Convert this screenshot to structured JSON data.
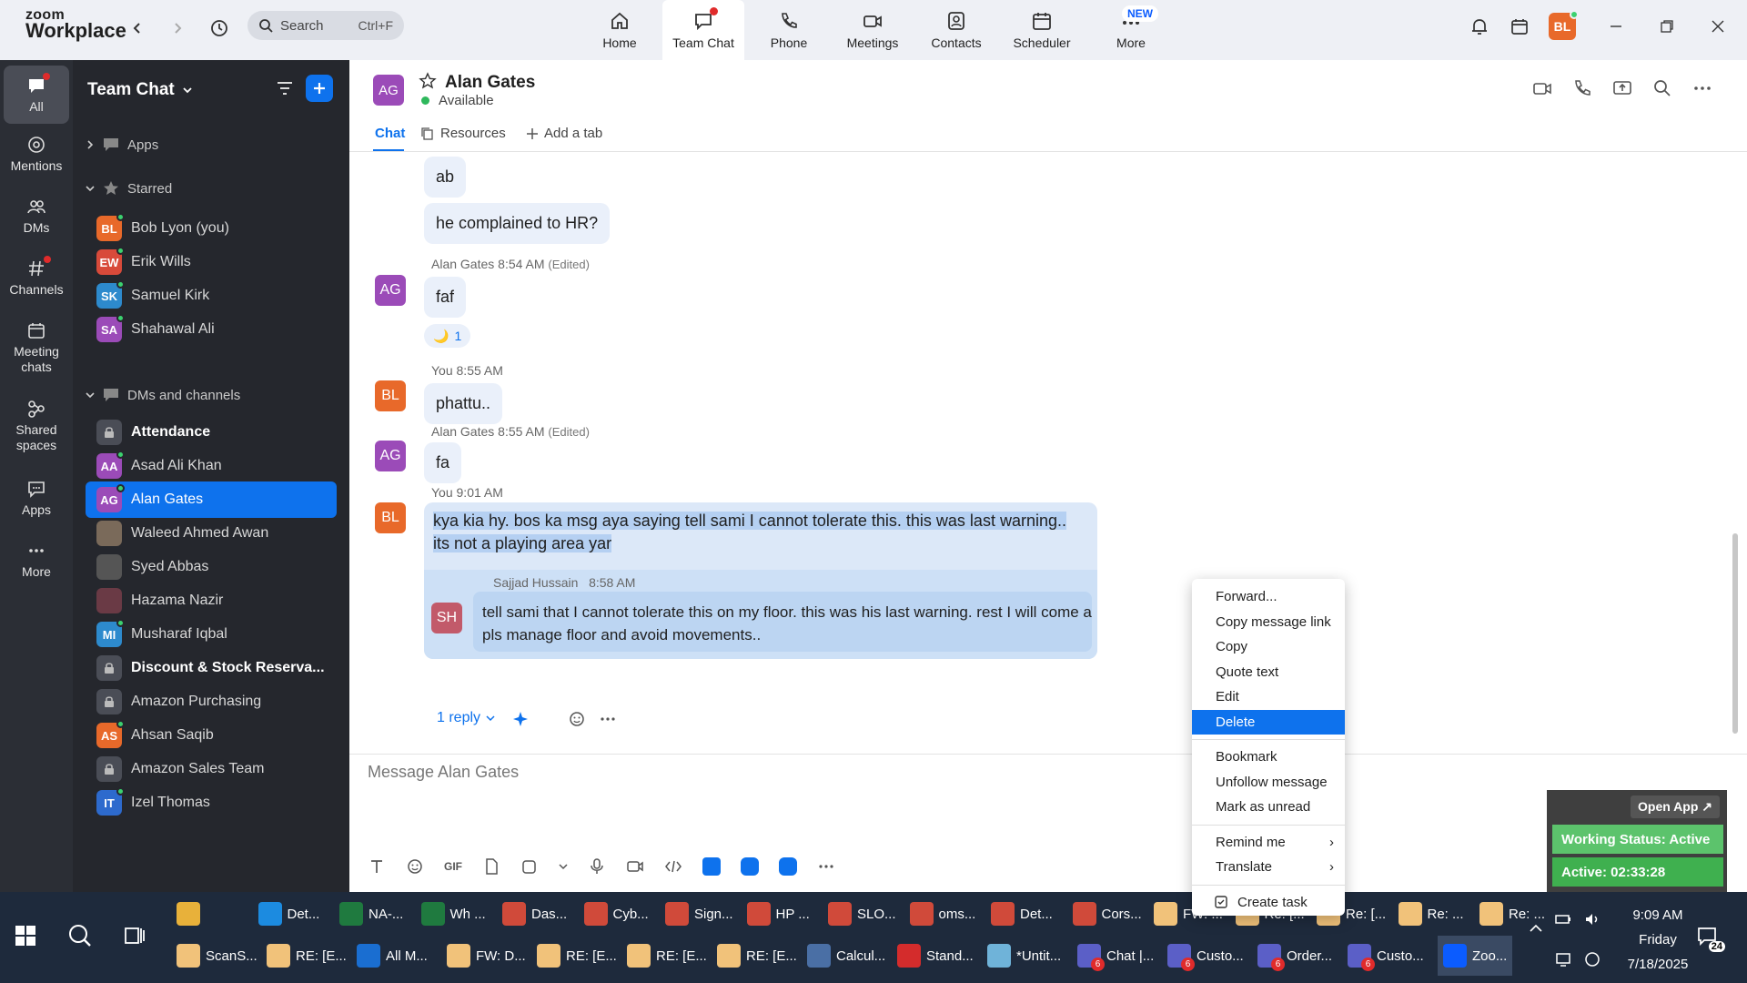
{
  "app": {
    "logo_line1": "zoom",
    "logo_line2": "Workplace"
  },
  "search": {
    "label": "Search",
    "shortcut": "Ctrl+F"
  },
  "nav": [
    {
      "label": "Home",
      "icon": "home-icon"
    },
    {
      "label": "Team Chat",
      "icon": "chat-icon"
    },
    {
      "label": "Phone",
      "icon": "phone-icon"
    },
    {
      "label": "Meetings",
      "icon": "video-icon"
    },
    {
      "label": "Contacts",
      "icon": "contacts-icon"
    },
    {
      "label": "Scheduler",
      "icon": "calendar-icon"
    },
    {
      "label": "More",
      "icon": "more-icon"
    }
  ],
  "new_badge": "NEW",
  "user_avatar": "BL",
  "rail": [
    {
      "label": "All"
    },
    {
      "label": "Mentions"
    },
    {
      "label": "DMs"
    },
    {
      "label": "Channels"
    },
    {
      "label": "Meeting chats"
    },
    {
      "label": "Shared spaces"
    },
    {
      "label": "Apps"
    },
    {
      "label": "More"
    }
  ],
  "side": {
    "title": "Team Chat",
    "apps_label": "Apps",
    "starred_label": "Starred",
    "starred": [
      {
        "initials": "BL",
        "name": "Bob Lyon (you)",
        "color": "#e8692a"
      },
      {
        "initials": "EW",
        "name": "Erik Wills",
        "color": "#d84a3a"
      },
      {
        "initials": "SK",
        "name": "Samuel Kirk",
        "color": "#2d8acd"
      },
      {
        "initials": "SA",
        "name": "Shahawal Ali",
        "color": "#9b4bb8"
      }
    ],
    "dms_label": "DMs and channels",
    "dms": [
      {
        "initials": "",
        "name": "Attendance",
        "color": "#4a4d56",
        "bold": true,
        "lock": true
      },
      {
        "initials": "AA",
        "name": "Asad Ali Khan",
        "color": "#9b4bb8"
      },
      {
        "initials": "AG",
        "name": "Alan Gates",
        "color": "#9b4bb8",
        "sel": true
      },
      {
        "initials": "",
        "name": "Waleed Ahmed Awan",
        "color": "#7a6a5a"
      },
      {
        "initials": "",
        "name": "Syed Abbas",
        "color": "#555"
      },
      {
        "initials": "",
        "name": "Hazama Nazir",
        "color": "#6a3a45"
      },
      {
        "initials": "MI",
        "name": "Musharaf Iqbal",
        "color": "#2d8acd"
      },
      {
        "initials": "",
        "name": "Discount & Stock Reserva...",
        "color": "#4a4d56",
        "bold": true,
        "lock": true
      },
      {
        "initials": "",
        "name": "Amazon Purchasing",
        "color": "#4a4d56",
        "lock": true
      },
      {
        "initials": "AS",
        "name": "Ahsan Saqib",
        "color": "#e8692a"
      },
      {
        "initials": "",
        "name": "Amazon Sales Team",
        "color": "#4a4d56",
        "lock": true
      },
      {
        "initials": "IT",
        "name": "Izel Thomas",
        "color": "#2d6acd"
      }
    ]
  },
  "chat": {
    "contact_initials": "AG",
    "contact_name": "Alan Gates",
    "contact_status": "Available",
    "tabs": [
      "Chat",
      "Resources",
      "Add a tab"
    ],
    "msg1": "ab",
    "msg2": "he complained to HR?",
    "meta3_name": "Alan Gates",
    "meta3_time": "8:54 AM",
    "meta3_edited": "(Edited)",
    "msg3": "faf",
    "reaction": "1",
    "meta4_name": "You",
    "meta4_time": "8:55 AM",
    "msg4": "phattu..",
    "meta5_name": "Alan Gates",
    "meta5_time": "8:55 AM",
    "meta5_edited": "(Edited)",
    "msg5": "fa",
    "meta6_name": "You",
    "meta6_time": "9:01 AM",
    "msg6_line1": "kya kia hy. bos ka msg aya saying tell sami I cannot tolerate this. this was last warning..",
    "msg6_line2": "its not a playing area yar",
    "quote_initials": "SH",
    "quote_name": "Sajjad Hussain",
    "quote_time": "8:58 AM",
    "quote_line1": "tell sami that I cannot tolerate this on my floor. this was his last warning. rest I will come and",
    "quote_line2": "pls manage floor and avoid movements..",
    "reply_label": "1 reply",
    "input_placeholder": "Message Alan Gates",
    "bl": "BL",
    "ag": "AG"
  },
  "context_menu": {
    "items1": [
      "Forward...",
      "Copy message link",
      "Copy",
      "Quote text",
      "Edit",
      "Delete"
    ],
    "items2": [
      "Bookmark",
      "Unfollow message",
      "Mark as unread"
    ],
    "items3": [
      "Remind me",
      "Translate"
    ],
    "items4": [
      "Create task"
    ],
    "highlighted": "Delete"
  },
  "widget": {
    "open_app": "Open App ↗",
    "working": "Working Status: Active",
    "active": "Active: 02:33:28"
  },
  "taskbar": {
    "row1": [
      {
        "label": "",
        "color": "#e8b13a"
      },
      {
        "label": "Det...",
        "color": "#1c8be0"
      },
      {
        "label": "NA-...",
        "color": "#1f7a3f"
      },
      {
        "label": "Wh ...",
        "color": "#1f7a3f"
      },
      {
        "label": "Das...",
        "color": "#d04a3a"
      },
      {
        "label": "Cyb...",
        "color": "#d04a3a"
      },
      {
        "label": "Sign...",
        "color": "#d04a3a"
      },
      {
        "label": "HP ...",
        "color": "#d04a3a"
      },
      {
        "label": "SLO...",
        "color": "#d04a3a"
      },
      {
        "label": "oms...",
        "color": "#d04a3a"
      },
      {
        "label": "Det...",
        "color": "#d04a3a"
      },
      {
        "label": "Cors...",
        "color": "#d04a3a"
      },
      {
        "label": "FW: ...",
        "color": "#f1c27a"
      },
      {
        "label": "Re: [...",
        "color": "#f1c27a"
      },
      {
        "label": "Re: [...",
        "color": "#f1c27a"
      },
      {
        "label": "Re: ...",
        "color": "#f1c27a"
      },
      {
        "label": "Re: ...",
        "color": "#f1c27a"
      }
    ],
    "row2": [
      {
        "label": "ScanS...",
        "color": "#f1c27a"
      },
      {
        "label": "RE: [E...",
        "color": "#f1c27a"
      },
      {
        "label": "All M...",
        "color": "#1a6ed1"
      },
      {
        "label": "FW: D...",
        "color": "#f1c27a"
      },
      {
        "label": "RE: [E...",
        "color": "#f1c27a"
      },
      {
        "label": "RE: [E...",
        "color": "#f1c27a"
      },
      {
        "label": "RE: [E...",
        "color": "#f1c27a"
      },
      {
        "label": "Calcul...",
        "color": "#4a6fa5"
      },
      {
        "label": "Stand...",
        "color": "#d42c2c"
      },
      {
        "label": "*Untit...",
        "color": "#6fb3d9"
      },
      {
        "label": "Chat |...",
        "color": "#5b5fc7",
        "badge": "6"
      },
      {
        "label": "Custo...",
        "color": "#5b5fc7",
        "badge": "6"
      },
      {
        "label": "Order...",
        "color": "#5b5fc7",
        "badge": "6"
      },
      {
        "label": "Custo...",
        "color": "#5b5fc7",
        "badge": "6"
      },
      {
        "label": "Zoo...",
        "color": "#0b5cff"
      }
    ],
    "time": "9:09 AM",
    "day": "Friday",
    "date": "7/18/2025",
    "notif": "24"
  }
}
